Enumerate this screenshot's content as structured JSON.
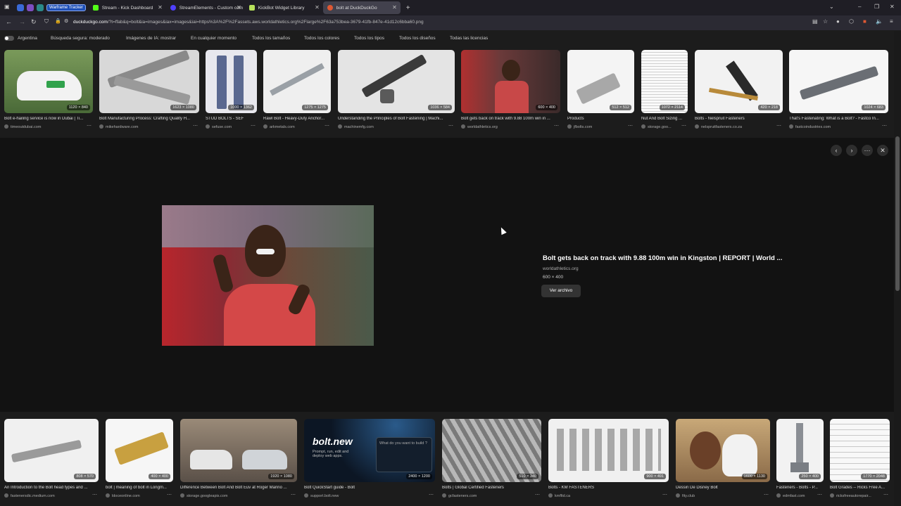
{
  "tabs": [
    {
      "label": "Warframe Tracker",
      "color": "#1e4fb7"
    },
    {
      "label": "Stream - Kick Dashboard",
      "color": "#53fc18"
    },
    {
      "label": "StreamElements - Custom com",
      "color": "#4f40ff"
    },
    {
      "label": "KickBot Widget Library",
      "color": "#b7e15b"
    },
    {
      "label": "bolt at DuckDuckGo",
      "color": "#de5833"
    }
  ],
  "url": {
    "domain": "duckduckgo.com",
    "rest": "/?t=ffab&q=bolt&ia=images&iax=images&iai=https%3A%2F%2Fassets.aws.worldathletics.org%2Flarge%2F63a753bea-3679-41fb-847e-41d12c6bba60.png"
  },
  "filters": [
    "Argentina",
    "Búsqueda segura: moderado",
    "Imágenes de IA: mostrar",
    "En cualquier momento",
    "Todos los tamaños",
    "Todos los colores",
    "Todos los tipos",
    "Todos los diseños",
    "Todas las licencias"
  ],
  "top_results": [
    {
      "caption": "Bolt e-hailing service is now in Dubai | Ti...",
      "source": "timeoutdubai.com",
      "dims": "1120 × 840",
      "color": "#6a8a52"
    },
    {
      "caption": "Bolt Manufacturing Process: Crafting Quality H...",
      "source": "mikehardware.com",
      "dims": "1623 × 1080",
      "color": "#cfcfcf"
    },
    {
      "caption": "STUD BOLTS - SEF",
      "source": "sefuse.com",
      "dims": "1000 × 1362",
      "color": "#6c7aa0"
    },
    {
      "caption": "Rawl Bolt - Heavy-Duty Anchor...",
      "source": "arkmetals.com",
      "dims": "1275 × 1275",
      "color": "#e6e6e6"
    },
    {
      "caption": "Understanding the Principles of Bolt Fastening | Machi...",
      "source": "machinemfg.com",
      "dims": "1036 × 584",
      "color": "#d6d6d6"
    },
    {
      "caption": "Bolt gets back on track with 9.88 100m win in ...",
      "source": "worldathletics.org",
      "dims": "600 × 400",
      "color": "#8a3a3a"
    },
    {
      "caption": "Products",
      "source": "jfbolts.com",
      "dims": "512 × 512",
      "color": "#eeeeee"
    },
    {
      "caption": "Nut And Bolt Sizing ...",
      "source": "storage.goo...",
      "dims": "1072 × 2114",
      "color": "#f2f2f2"
    },
    {
      "caption": "Bolts - Nelspruit Fasteners",
      "source": "nelspruitfasteners.co.za",
      "dims": "420 × 218",
      "color": "#f0f0f0"
    },
    {
      "caption": "That's Fastenating: What is a Bolt? - Fastco In...",
      "source": "fastcoindustries.com",
      "dims": "1024 × 683",
      "color": "#f4f4f4"
    }
  ],
  "preview": {
    "title": "Bolt gets back on track with 9.88 100m win in Kingston | REPORT | World ...",
    "site": "worldathletics.org",
    "dims": "600 × 400",
    "button": "Ver archivo"
  },
  "bottom_results": [
    {
      "caption": "An Introduction to the Bolt head types and ...",
      "source": "fastenersdic.medium.com",
      "dims": "808 × 570",
      "color": "#efefef"
    },
    {
      "caption": "bolt | meaning of bolt in Longm...",
      "source": "ldoceonline.com",
      "dims": "400 × 400",
      "color": "#f5f5f5"
    },
    {
      "caption": "Difference Between Bolt And Bolt Euv at Roger Marino ...",
      "source": "storage.googleapis.com",
      "dims": "1920 × 1080",
      "color": "#a89b88"
    },
    {
      "caption": "Bolt QuickStart guide - Bolt",
      "source": "support.bolt.new",
      "dims": "2400 × 1200",
      "color": "#0c1624"
    },
    {
      "caption": "Bolts | Global Certified Fasteners",
      "source": "gcfasteners.com",
      "dims": "510 × 340",
      "color": "#9a9a9a"
    },
    {
      "caption": "Bolts - KM FASTENERS",
      "source": "kmfltd.ca",
      "dims": "900 × 491",
      "color": "#f0f0f0"
    },
    {
      "caption": "Dessin De Disney Bolt",
      "source": "fity.club",
      "dims": "1600 × 1130",
      "color": "#b89870"
    },
    {
      "caption": "Fasteners - Bolts - P...",
      "source": "edmfast.com",
      "dims": "250 × 400",
      "color": "#f2f2f2"
    },
    {
      "caption": "Bolt Grades -- Ricks Free A...",
      "source": "ricksfreeautorepair...",
      "dims": "1770 × 2048",
      "color": "#f7f7f7"
    }
  ],
  "boltnew": {
    "logo": "bolt.new",
    "tagline": "Prompt, run, edit and deploy web apps.",
    "prompt": "What do you want to build ?"
  }
}
